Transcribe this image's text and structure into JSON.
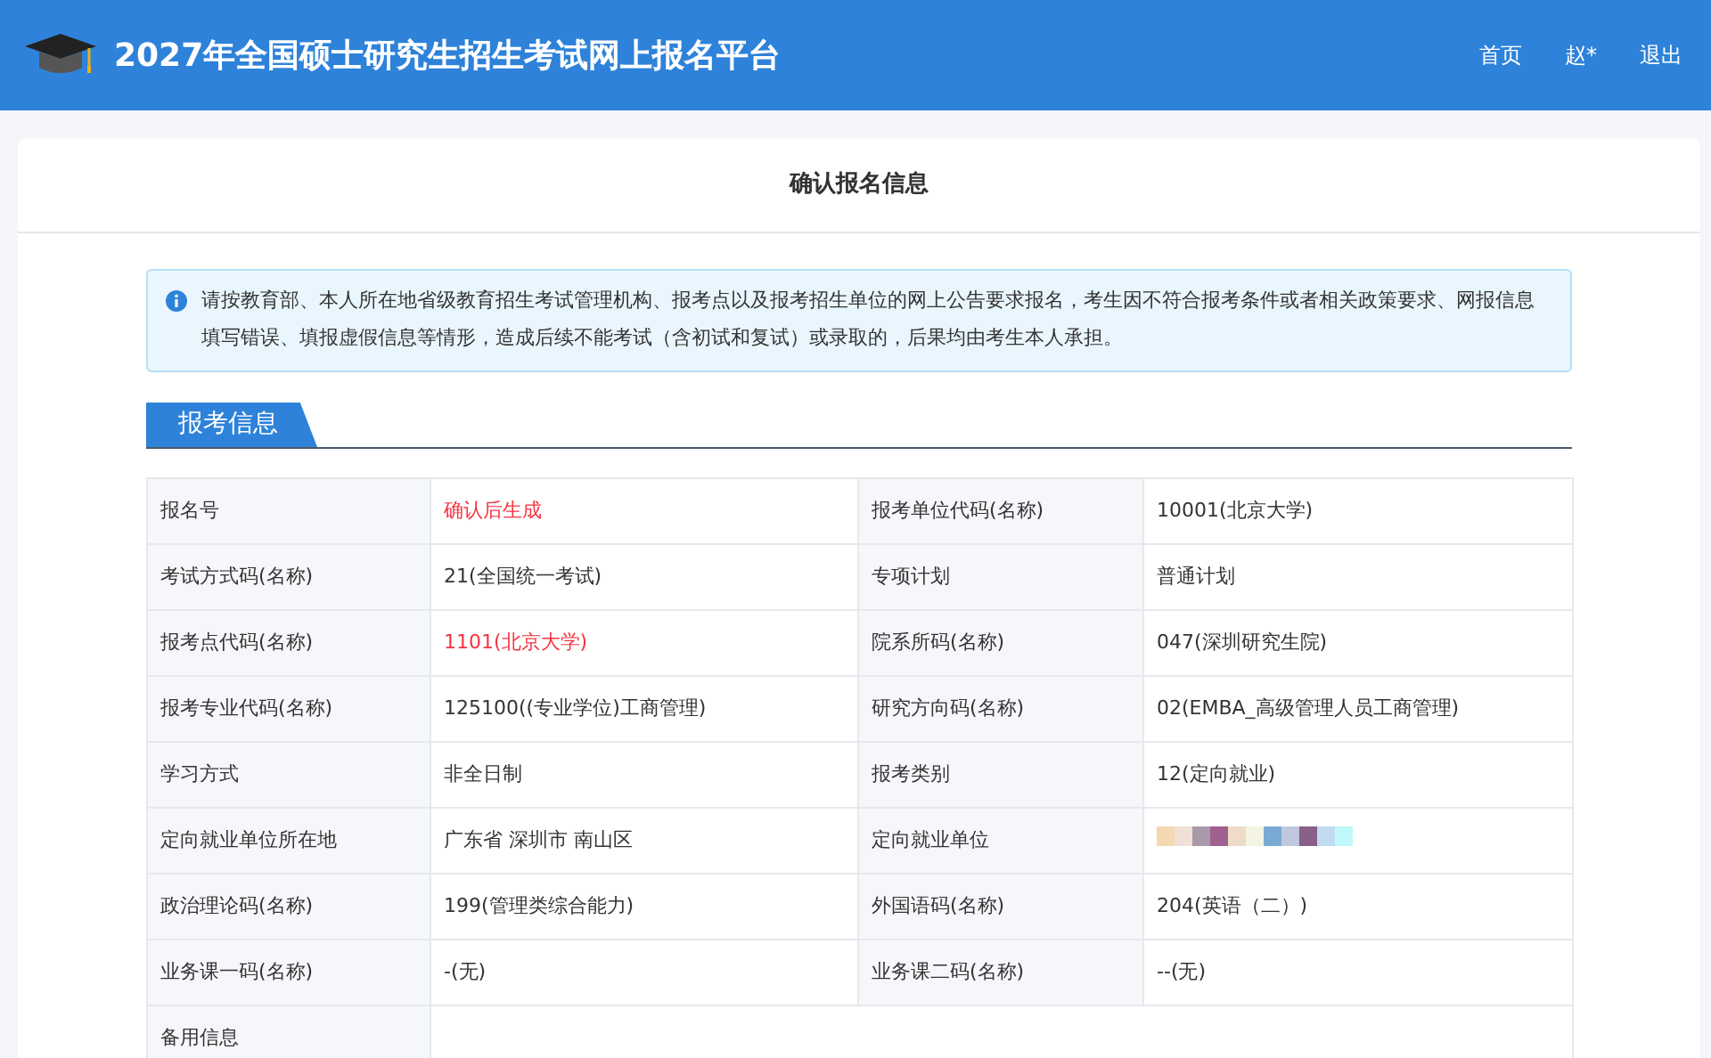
{
  "header": {
    "title": "2027年全国硕士研究生招生考试网上报名平台",
    "nav": [
      "首页",
      "赵*",
      "退出"
    ]
  },
  "card": {
    "title": "确认报名信息"
  },
  "notice": "请按教育部、本人所在地省级教育招生考试管理机构、报考点以及报考招生单位的网上公告要求报名，考生因不符合报考条件或者相关政策要求、网报信息填写错误、填报虚假信息等情形，造成后续不能考试（含初试和复试）或录取的，后果均由考生本人承担。",
  "section": {
    "title": "报考信息"
  },
  "table": {
    "rows": [
      {
        "cells": [
          {
            "label": "报名号",
            "value": "确认后生成",
            "highlight": true
          },
          {
            "label": "报考单位代码(名称)",
            "value": "10001(北京大学)",
            "highlight": false
          }
        ]
      },
      {
        "cells": [
          {
            "label": "考试方式码(名称)",
            "value": "21(全国统一考试)",
            "highlight": false
          },
          {
            "label": "专项计划",
            "value": "普通计划",
            "highlight": false
          }
        ]
      },
      {
        "cells": [
          {
            "label": "报考点代码(名称)",
            "value": "1101(北京大学)",
            "highlight": true
          },
          {
            "label": "院系所码(名称)",
            "value": "047(深圳研究生院)",
            "highlight": false
          }
        ]
      },
      {
        "cells": [
          {
            "label": "报考专业代码(名称)",
            "value": "125100((专业学位)工商管理)",
            "highlight": false
          },
          {
            "label": "研究方向码(名称)",
            "value": "02(EMBA_高级管理人员工商管理)",
            "highlight": false
          }
        ]
      },
      {
        "cells": [
          {
            "label": "学习方式",
            "value": "非全日制",
            "highlight": false
          },
          {
            "label": "报考类别",
            "value": "12(定向就业)",
            "highlight": false
          }
        ]
      },
      {
        "cells": [
          {
            "label": "定向就业单位所在地",
            "value": "广东省 深圳市 南山区",
            "highlight": false
          },
          {
            "label": "定向就业单位",
            "kind": "redacted"
          }
        ]
      },
      {
        "cells": [
          {
            "label": "政治理论码(名称)",
            "value": "199(管理类综合能力)",
            "highlight": false
          },
          {
            "label": "外国语码(名称)",
            "value": "204(英语（二）)",
            "highlight": false
          }
        ]
      },
      {
        "cells": [
          {
            "label": "业务课一码(名称)",
            "value": "-(无)",
            "highlight": false
          },
          {
            "label": "业务课二码(名称)",
            "value": "--(无)",
            "highlight": false
          }
        ]
      },
      {
        "cells": [
          {
            "label": "备用信息"
          }
        ]
      }
    ]
  }
}
